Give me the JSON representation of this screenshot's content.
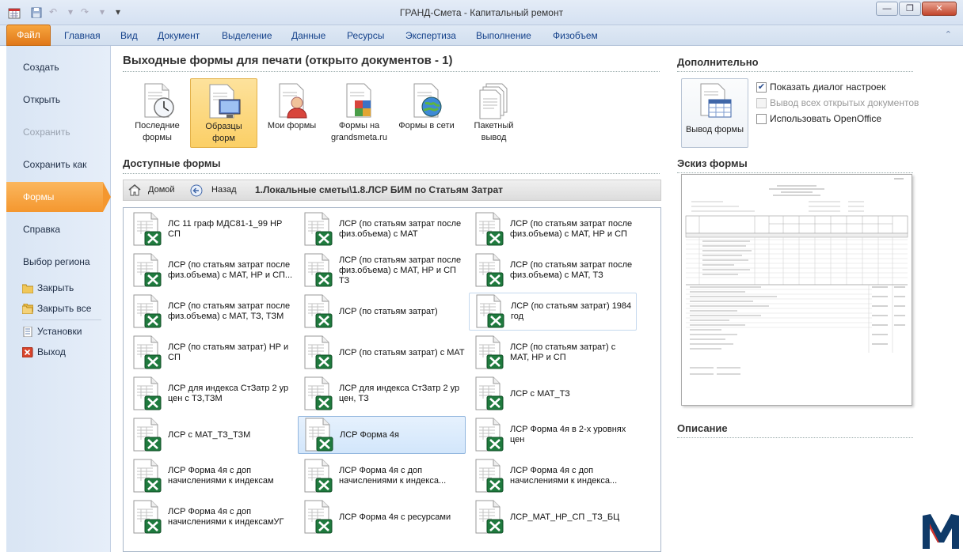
{
  "window": {
    "title": "ГРАНД-Смета - Капитальный ремонт",
    "minimize_glyph": "—",
    "restore_glyph": "❐",
    "close_glyph": "✕"
  },
  "quick_access": {
    "save_icon": "save-icon",
    "undo_icon": "undo-icon",
    "redo_icon": "redo-icon",
    "customize_glyph": "▾"
  },
  "ribbon": {
    "file_tab": "Файл",
    "tabs": [
      "Главная",
      "Вид",
      "Документ",
      "Выделение",
      "Данные",
      "Ресурсы",
      "Экспертиза",
      "Выполнение",
      "Физобъем"
    ],
    "minimize_glyph": "⌃"
  },
  "sidebar": {
    "items": [
      {
        "label": "Создать",
        "state": "normal"
      },
      {
        "label": "Открыть",
        "state": "normal"
      },
      {
        "label": "Сохранить",
        "state": "disabled"
      },
      {
        "label": "Сохранить как",
        "state": "normal"
      },
      {
        "label": "Формы",
        "state": "active"
      },
      {
        "label": "Справка",
        "state": "normal"
      },
      {
        "label": "Выбор региона",
        "state": "normal"
      }
    ],
    "small_items": [
      {
        "label": "Закрыть",
        "icon": "folder-icon"
      },
      {
        "label": "Закрыть все",
        "icon": "folders-icon"
      },
      {
        "label": "Установки",
        "icon": "settings-icon"
      },
      {
        "label": "Выход",
        "icon": "exit-icon"
      }
    ]
  },
  "main": {
    "heading": "Выходные формы для печати (открыто документов - 1)",
    "tiles": [
      {
        "label1": "Последние",
        "label2": "формы",
        "icon": "clock-document-icon",
        "active": false
      },
      {
        "label1": "Образцы",
        "label2": "форм",
        "icon": "monitor-document-icon",
        "active": true
      },
      {
        "label1": "Мои формы",
        "label2": "",
        "icon": "user-document-icon",
        "active": false
      },
      {
        "label1": "Формы на",
        "label2": "grandsmeta.ru",
        "icon": "cubes-document-icon",
        "active": false
      },
      {
        "label1": "Формы в сети",
        "label2": "",
        "icon": "globe-document-icon",
        "active": false
      },
      {
        "label1": "Пакетный",
        "label2": "вывод",
        "icon": "stack-documents-icon",
        "active": false
      }
    ],
    "available_heading": "Доступные формы",
    "nav": {
      "home": "Домой",
      "back": "Назад",
      "path": "1.Локальные сметы\\1.8.ЛСР БИМ по Статьям Затрат"
    },
    "forms": [
      {
        "l1": "ЛС 11 граф МДС81-1_99 НР СП",
        "l2": ""
      },
      {
        "l1": "ЛСР (по статьям затрат после",
        "l2": "физ.объема) с МАТ"
      },
      {
        "l1": "ЛСР (по статьям затрат после",
        "l2": "физ.объема) с МАТ, НР и СП"
      },
      {
        "l1": "ЛСР (по статьям затрат после",
        "l2": "физ.объема) с МАТ, НР и СП..."
      },
      {
        "l1": "ЛСР (по статьям затрат после",
        "l2": "физ.объема) с МАТ, НР и СП ТЗ"
      },
      {
        "l1": "ЛСР (по статьям затрат после",
        "l2": "физ.объема) с МАТ, ТЗ"
      },
      {
        "l1": "ЛСР (по статьям затрат после",
        "l2": "физ.объема) с МАТ, ТЗ, ТЗМ"
      },
      {
        "l1": "ЛСР (по статьям затрат)",
        "l2": ""
      },
      {
        "l1": "ЛСР (по статьям затрат) 1984",
        "l2": "год"
      },
      {
        "l1": "ЛСР (по статьям затрат) НР и",
        "l2": "СП"
      },
      {
        "l1": "ЛСР (по статьям затрат) с МАТ",
        "l2": ""
      },
      {
        "l1": "ЛСР (по статьям затрат) с",
        "l2": "МАТ, НР и СП"
      },
      {
        "l1": "ЛСР для индекса СтЗатр 2 ур",
        "l2": "цен с ТЗ,ТЗМ"
      },
      {
        "l1": "ЛСР для индекса СтЗатр 2 ур",
        "l2": "цен, ТЗ"
      },
      {
        "l1": "ЛСР с МАТ_ТЗ",
        "l2": ""
      },
      {
        "l1": "ЛСР с МАТ_ТЗ_ТЗМ",
        "l2": ""
      },
      {
        "l1": "ЛСР Форма 4я",
        "l2": ""
      },
      {
        "l1": "ЛСР Форма 4я в 2-х уровнях",
        "l2": "цен"
      },
      {
        "l1": "ЛСР Форма 4я с доп",
        "l2": "начислениями к индексам"
      },
      {
        "l1": "ЛСР Форма 4я с доп",
        "l2": "начислениями к индекса..."
      },
      {
        "l1": "ЛСР Форма 4я с доп",
        "l2": "начислениями к индекса..."
      },
      {
        "l1": "ЛСР Форма 4я с доп",
        "l2": "начислениями к индексамУГ"
      },
      {
        "l1": "ЛСР Форма 4я с ресурсами",
        "l2": ""
      },
      {
        "l1": "ЛСР_МАТ_НР_СП _ТЗ_БЦ",
        "l2": ""
      }
    ],
    "selected_form_index": 16,
    "hovered_form_index": 8
  },
  "right": {
    "extra_heading": "Дополнительно",
    "output_button": "Вывод формы",
    "checkboxes": [
      {
        "label": "Показать диалог настроек",
        "checked": true,
        "disabled": false
      },
      {
        "label": "Вывод всех открытых документов",
        "checked": false,
        "disabled": true
      },
      {
        "label": "Использовать OpenOffice",
        "checked": false,
        "disabled": false
      }
    ],
    "sketch_heading": "Эскиз формы",
    "description_heading": "Описание"
  },
  "colors": {
    "accent_orange": "#f4972f",
    "ribbon_blue": "#15428b",
    "selection_blue": "#d2e6fb"
  }
}
